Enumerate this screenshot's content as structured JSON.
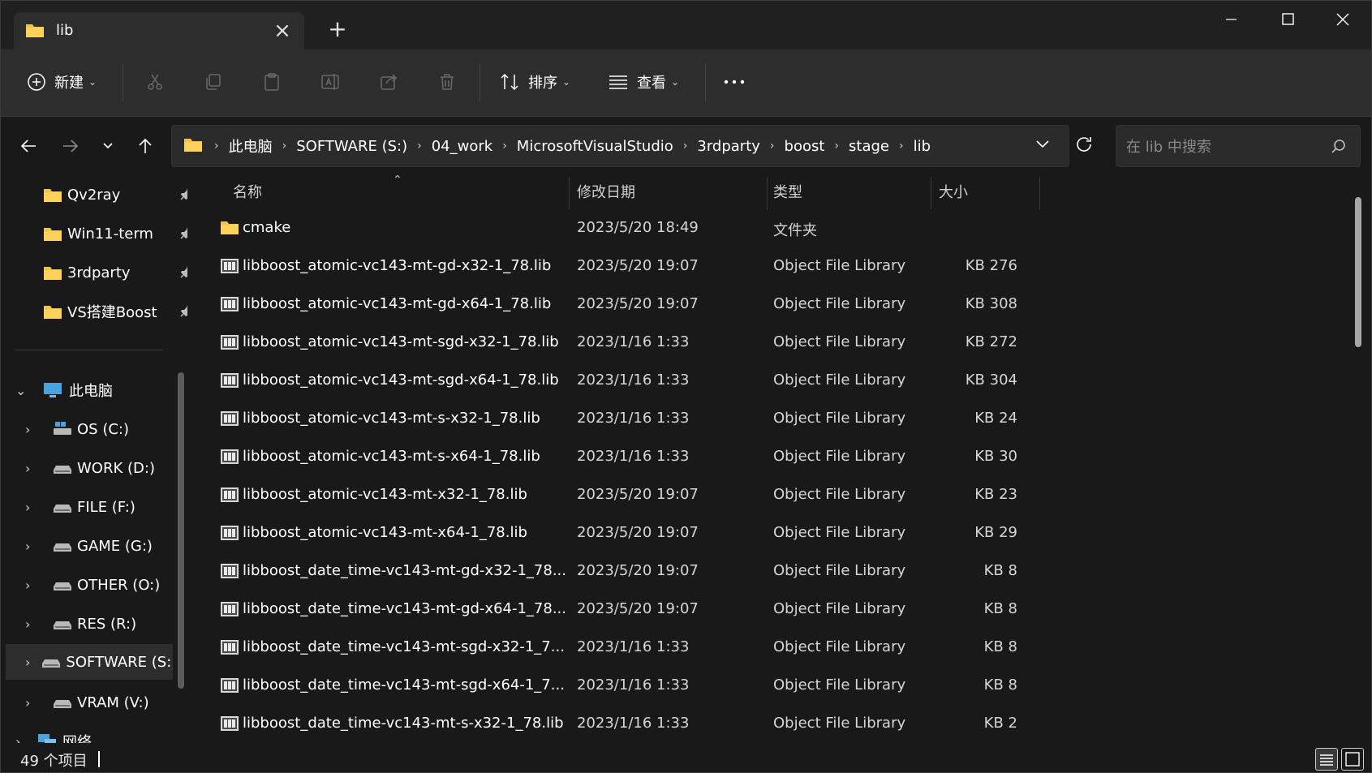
{
  "tab": {
    "title": "lib",
    "close_icon": "close-icon",
    "new_tab_icon": "plus-icon"
  },
  "window_controls": {
    "minimize": "minimize-icon",
    "maximize": "maximize-icon",
    "close": "close-icon"
  },
  "toolbar": {
    "new_label": "新建",
    "sort_label": "排序",
    "view_label": "查看",
    "more_icon": "more-icon"
  },
  "address": {
    "crumbs": [
      "此电脑",
      "SOFTWARE (S:)",
      "04_work",
      "MicrosoftVisualStudio",
      "3rdparty",
      "boost",
      "stage",
      "lib"
    ]
  },
  "search": {
    "placeholder": "在 lib 中搜索"
  },
  "sidebar": {
    "quick_access": [
      {
        "label": "Qv2ray"
      },
      {
        "label": "Win11-term"
      },
      {
        "label": "3rdparty"
      },
      {
        "label": "VS搭建Boost"
      }
    ],
    "this_pc": "此电脑",
    "drives": [
      {
        "label": "OS (C:)"
      },
      {
        "label": "WORK (D:)"
      },
      {
        "label": "FILE (F:)"
      },
      {
        "label": "GAME (G:)"
      },
      {
        "label": "OTHER (O:)"
      },
      {
        "label": "RES (R:)"
      },
      {
        "label": "SOFTWARE (S:)"
      },
      {
        "label": "VRAM (V:)"
      }
    ],
    "network": "网络"
  },
  "columns": {
    "name": "名称",
    "date": "修改日期",
    "type": "类型",
    "size": "大小"
  },
  "files": [
    {
      "name": "cmake",
      "date": "2023/5/20 18:49",
      "type": "文件夹",
      "size": "",
      "kind": "folder"
    },
    {
      "name": "libboost_atomic-vc143-mt-gd-x32-1_78.lib",
      "date": "2023/5/20 19:07",
      "type": "Object File Library",
      "size": "276 KB",
      "kind": "lib"
    },
    {
      "name": "libboost_atomic-vc143-mt-gd-x64-1_78.lib",
      "date": "2023/5/20 19:07",
      "type": "Object File Library",
      "size": "308 KB",
      "kind": "lib"
    },
    {
      "name": "libboost_atomic-vc143-mt-sgd-x32-1_78.lib",
      "date": "2023/1/16 1:33",
      "type": "Object File Library",
      "size": "272 KB",
      "kind": "lib"
    },
    {
      "name": "libboost_atomic-vc143-mt-sgd-x64-1_78.lib",
      "date": "2023/1/16 1:33",
      "type": "Object File Library",
      "size": "304 KB",
      "kind": "lib"
    },
    {
      "name": "libboost_atomic-vc143-mt-s-x32-1_78.lib",
      "date": "2023/1/16 1:33",
      "type": "Object File Library",
      "size": "24 KB",
      "kind": "lib"
    },
    {
      "name": "libboost_atomic-vc143-mt-s-x64-1_78.lib",
      "date": "2023/1/16 1:33",
      "type": "Object File Library",
      "size": "30 KB",
      "kind": "lib"
    },
    {
      "name": "libboost_atomic-vc143-mt-x32-1_78.lib",
      "date": "2023/5/20 19:07",
      "type": "Object File Library",
      "size": "23 KB",
      "kind": "lib"
    },
    {
      "name": "libboost_atomic-vc143-mt-x64-1_78.lib",
      "date": "2023/5/20 19:07",
      "type": "Object File Library",
      "size": "29 KB",
      "kind": "lib"
    },
    {
      "name": "libboost_date_time-vc143-mt-gd-x32-1_78...",
      "date": "2023/5/20 19:07",
      "type": "Object File Library",
      "size": "8 KB",
      "kind": "lib"
    },
    {
      "name": "libboost_date_time-vc143-mt-gd-x64-1_78...",
      "date": "2023/5/20 19:07",
      "type": "Object File Library",
      "size": "8 KB",
      "kind": "lib"
    },
    {
      "name": "libboost_date_time-vc143-mt-sgd-x32-1_7...",
      "date": "2023/1/16 1:33",
      "type": "Object File Library",
      "size": "8 KB",
      "kind": "lib"
    },
    {
      "name": "libboost_date_time-vc143-mt-sgd-x64-1_7...",
      "date": "2023/1/16 1:33",
      "type": "Object File Library",
      "size": "8 KB",
      "kind": "lib"
    },
    {
      "name": "libboost_date_time-vc143-mt-s-x32-1_78.lib",
      "date": "2023/1/16 1:33",
      "type": "Object File Library",
      "size": "2 KB",
      "kind": "lib"
    }
  ],
  "status": {
    "item_count": "49 个项目"
  },
  "colors": {
    "folder": "#f5c342",
    "background": "#191919",
    "toolbar": "#2d2d2d",
    "drive_blue": "#4aa3df"
  }
}
